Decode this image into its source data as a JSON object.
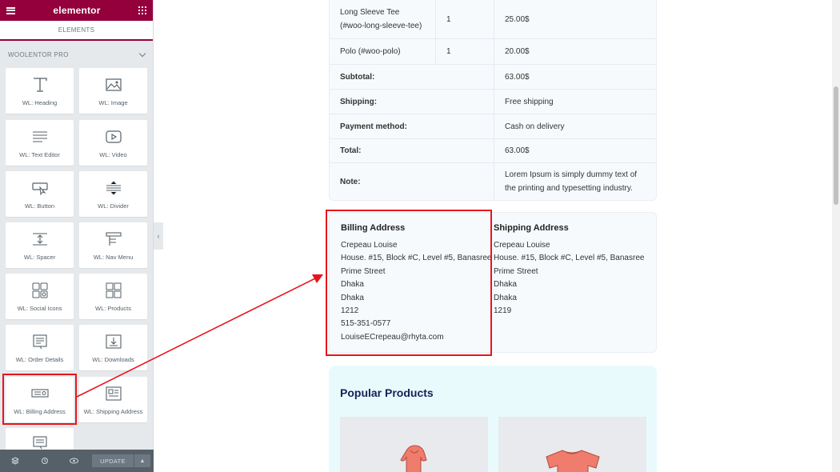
{
  "panel": {
    "brand": "elementor",
    "tab": "ELEMENTS",
    "category": "WOOLENTOR PRO",
    "widgets": [
      {
        "label": "WL: Heading",
        "icon": "heading-icon"
      },
      {
        "label": "WL: Image",
        "icon": "image-icon"
      },
      {
        "label": "WL: Text Editor",
        "icon": "text-editor-icon"
      },
      {
        "label": "WL: Video",
        "icon": "video-icon"
      },
      {
        "label": "WL: Button",
        "icon": "button-icon"
      },
      {
        "label": "WL: Divider",
        "icon": "divider-icon"
      },
      {
        "label": "WL: Spacer",
        "icon": "spacer-icon"
      },
      {
        "label": "WL: Nav Menu",
        "icon": "nav-menu-icon"
      },
      {
        "label": "WL: Social Icons",
        "icon": "social-icons-icon"
      },
      {
        "label": "WL: Products",
        "icon": "products-icon"
      },
      {
        "label": "WL: Order Details",
        "icon": "order-details-icon"
      },
      {
        "label": "WL: Downloads",
        "icon": "downloads-icon"
      },
      {
        "label": "WL: Billing Address",
        "icon": "billing-address-icon"
      },
      {
        "label": "WL: Shipping Address",
        "icon": "shipping-address-icon"
      },
      {
        "label": "",
        "icon": "order-notes-icon"
      }
    ],
    "footer": {
      "update_label": "UPDATE"
    }
  },
  "order": {
    "items": [
      {
        "name": "Long Sleeve Tee (#woo-long-sleeve-tee)",
        "qty": "1",
        "price": "25.00$"
      },
      {
        "name": "Polo (#woo-polo)",
        "qty": "1",
        "price": "20.00$"
      }
    ],
    "totals": [
      {
        "label": "Subtotal:",
        "value": "63.00$"
      },
      {
        "label": "Shipping:",
        "value": "Free shipping"
      },
      {
        "label": "Payment method:",
        "value": "Cash on delivery"
      },
      {
        "label": "Total:",
        "value": "63.00$"
      },
      {
        "label": "Note:",
        "value": "Lorem Ipsum is simply dummy text of the printing and typesetting industry."
      }
    ]
  },
  "billing": {
    "title": "Billing Address",
    "name": "Crepeau Louise",
    "street": "House. #15, Block #C, Level #5, Banasree Prime Street",
    "city": "Dhaka",
    "state": "Dhaka",
    "postcode": "1212",
    "phone": "515-351-0577",
    "email": "LouiseECrepeau@rhyta.com"
  },
  "shipping": {
    "title": "Shipping Address",
    "name": "Crepeau Louise",
    "street": "House. #15, Block #C, Level #5, Banasree Prime Street",
    "city": "Dhaka",
    "state": "Dhaka",
    "postcode": "1219"
  },
  "popular": {
    "title": "Popular Products"
  },
  "colors": {
    "elementor_brand": "#93003c",
    "highlight_red": "#e8141b",
    "heading_navy": "#1a1f5a"
  }
}
